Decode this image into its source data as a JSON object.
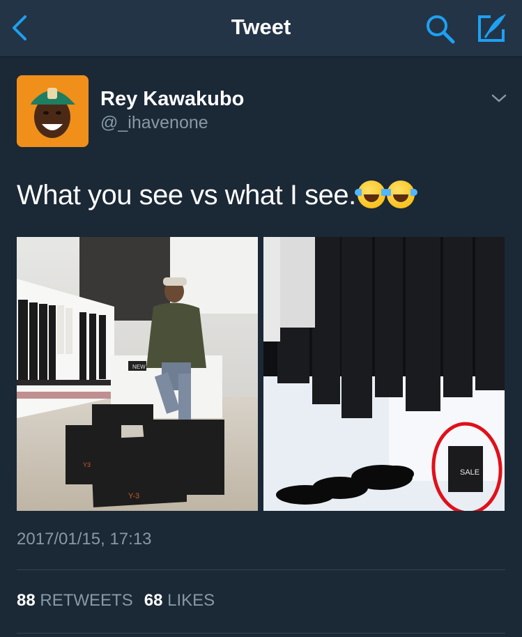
{
  "nav": {
    "title": "Tweet",
    "back_icon": "chevron-left-icon",
    "search_icon": "search-icon",
    "compose_icon": "compose-icon",
    "accent": "#1da1f2"
  },
  "tweet": {
    "author_name": "Rey Kawakubo",
    "author_handle": "@_ihavenone",
    "text": "What you see vs what I see.",
    "emoji": "face-with-tears-of-joy x2",
    "timestamp": "2017/01/15, 17:13",
    "retweets_count": "88",
    "retweets_label": "RETWEETS",
    "likes_count": "68",
    "likes_label": "LIKES",
    "photo_left": {
      "description": "man sitting in store with shopping bags",
      "sign_text": "NEW",
      "bag_text": "Y-3"
    },
    "photo_right": {
      "description": "clothes rack with shoes, sale sign circled in red",
      "sign_text": "SALE"
    }
  },
  "colors": {
    "nav_bg": "#243447",
    "body_bg": "#1b2836",
    "secondary_text": "#8899a6",
    "circle_highlight": "#e0101b"
  }
}
